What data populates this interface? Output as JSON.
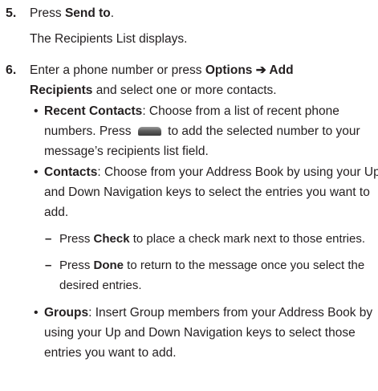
{
  "step5": {
    "number": "5.",
    "text_prefix": "Press ",
    "text_bold": "Send to",
    "text_suffix": ".",
    "result": "The Recipients List displays."
  },
  "step6": {
    "number": "6.",
    "line1_prefix": "Enter a phone number or press ",
    "line1_bold": "Options ➔ Add",
    "line2_bold": "Recipients",
    "line2_suffix": " and select one or more contacts.",
    "bullets": [
      {
        "bullet": "•",
        "lines": [
          {
            "bold": "Recent Contacts",
            "text": ": Choose from a list of recent phone"
          },
          {
            "pre": "numbers. Press ",
            "icon": "key-icon",
            "text": " to add the selected number to your"
          },
          {
            "text": "message’s recipients list field."
          }
        ]
      },
      {
        "bullet": "•",
        "lines": [
          {
            "bold": "Contacts",
            "text": ": Choose from your Address Book by using your Up"
          },
          {
            "text": "and Down Navigation keys to select the entries you want to"
          },
          {
            "text": "add."
          }
        ],
        "sub": [
          {
            "dash": "–",
            "pre": "Press ",
            "bold": "Check",
            "text": " to place a check mark next to those entries."
          },
          {
            "dash": "–",
            "pre": "Press ",
            "bold": "Done",
            "text": " to return to the message once you select the",
            "text2": "desired entries."
          }
        ]
      },
      {
        "bullet": "•",
        "lines": [
          {
            "bold": "Groups",
            "text": ": Insert Group members from your Address Book by"
          },
          {
            "text": "using your Up and Down Navigation keys to select those"
          },
          {
            "text": "entries you want to add."
          }
        ]
      }
    ]
  }
}
